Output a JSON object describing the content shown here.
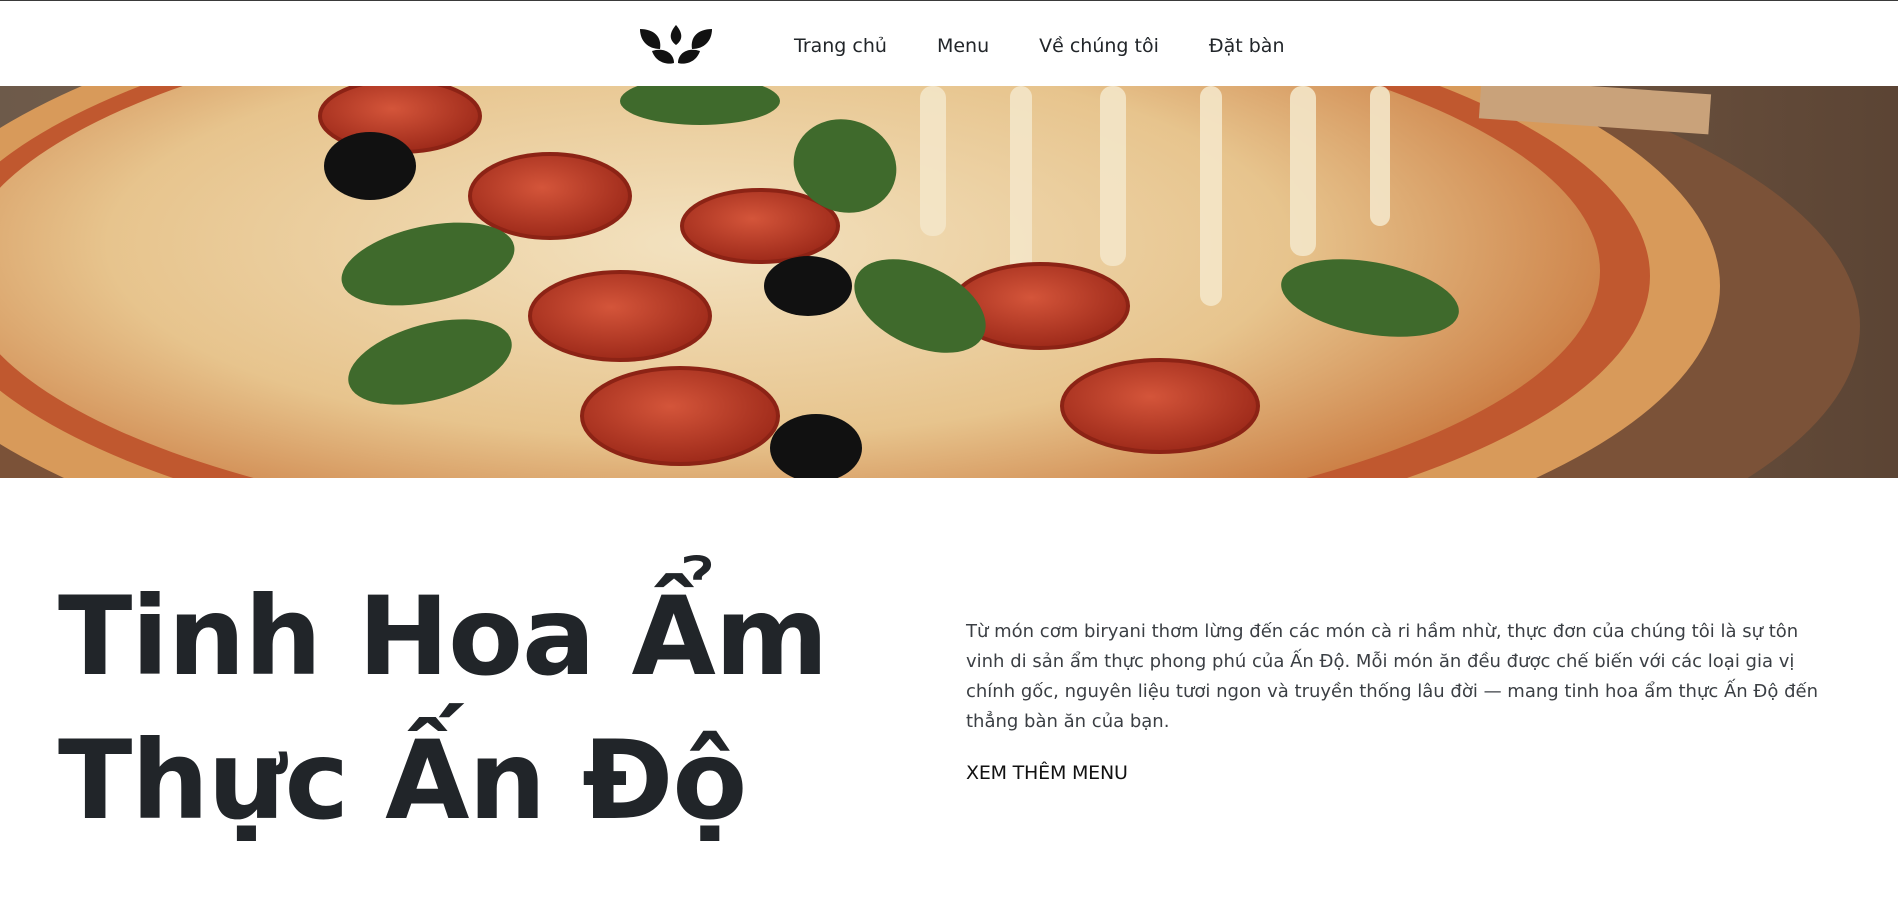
{
  "navbar": {
    "logo_icon": "lotus-leaves-icon",
    "links": [
      {
        "label": "Trang chủ"
      },
      {
        "label": "Menu"
      },
      {
        "label": "Về chúng tôi"
      },
      {
        "label": "Đặt bàn"
      }
    ]
  },
  "hero": {
    "image_icon": "pizza-photo"
  },
  "main": {
    "title_line1": "Tinh Hoa Ẩm",
    "title_line2": "Thực Ấn Độ",
    "description": "Từ món cơm biryani thơm lừng đến các món cà ri hầm nhừ, thực đơn của chúng tôi là sự tôn vinh di sản ẩm thực phong phú của Ấn Độ. Mỗi món ăn đều được chế biến với các loại gia vị chính gốc, nguyên liệu tươi ngon và truyền thống lâu đời — mang tinh hoa ẩm thực Ấn Độ đến thẳng bàn ăn của bạn.",
    "cta_label": "XEM THÊM MENU"
  },
  "colors": {
    "text": "#212529",
    "background": "#ffffff"
  }
}
